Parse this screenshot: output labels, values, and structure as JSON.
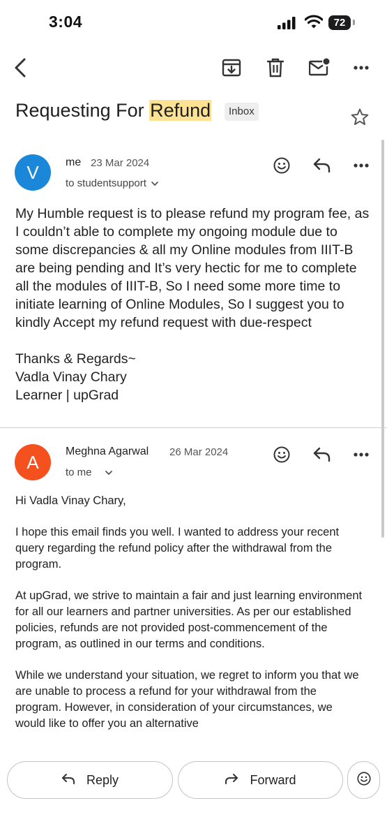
{
  "status_bar": {
    "time": "3:04",
    "battery": "72"
  },
  "email": {
    "subject_prefix": "Requesting For ",
    "subject_highlight": "Refund",
    "label": "Inbox"
  },
  "messages": [
    {
      "avatar_letter": "V",
      "avatar_color": "#1a87d9",
      "sender": "me",
      "date": "23 Mar 2024",
      "to": "to studentsupport",
      "body": "My Humble request is to please refund my program fee, as I couldn’t able to complete my ongoing module due to some discrepancies & all my Online modules from IIIT-B are being pending and It’s very hectic for me to complete all the modules of IIIT-B, So I need some more time to initiate learning of Online Modules, So I suggest you to kindly Accept my refund request with due-respect",
      "signoff": [
        "Thanks & Regards~",
        "Vadla Vinay Chary",
        "Learner | upGrad"
      ]
    },
    {
      "avatar_letter": "A",
      "avatar_color": "#f4511e",
      "sender": "Meghna Agarwal",
      "date": "26 Mar 2024",
      "to": "to me",
      "paragraphs": [
        "Hi Vadla Vinay Chary,",
        "I hope this email finds you well. I wanted to address your recent query regarding the refund policy after the withdrawal from the program.",
        "At upGrad, we strive to maintain a fair and just learning environment for all our learners and partner universities. As per our established policies, refunds are not provided post-commencement of the program, as outlined in our terms and conditions.",
        "While we understand your situation, we regret to inform you that we are unable to process a refund for your withdrawal from the program. However, in consideration of your circumstances, we would like to offer you an alternative"
      ]
    }
  ],
  "actions": {
    "reply": "Reply",
    "forward": "Forward"
  },
  "icons": [
    "back-icon",
    "archive-icon",
    "delete-icon",
    "mark-unread-icon",
    "more-icon",
    "star-icon",
    "emoji-icon",
    "reply-icon",
    "forward-icon"
  ]
}
